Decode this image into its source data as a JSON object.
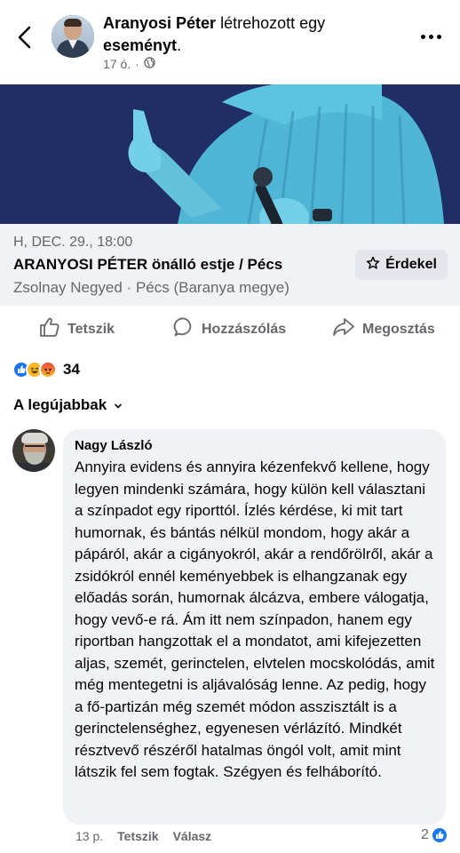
{
  "post": {
    "author": "Aranyosi Péter",
    "action": " létrehozott egy ",
    "object": "eseményt",
    "object_suffix": ".",
    "time": "17 ó.",
    "audience_icon": "globe-icon"
  },
  "event": {
    "date": "H, DEC. 29., 18:00",
    "name": "ARANYOSI PÉTER önálló estje / Pécs",
    "place": "Zsolnay Negyed · Pécs (Baranya megye)",
    "interest_label": "Érdekel"
  },
  "actions": {
    "like": "Tetszik",
    "comment": "Hozzászólás",
    "share": "Megosztás"
  },
  "reactions": {
    "count": "34",
    "types": [
      "like-icon",
      "haha-icon",
      "angry-icon"
    ]
  },
  "sort": {
    "label": "A legújabbak"
  },
  "comment": {
    "author": "Nagy László",
    "text": "Annyira evidens és annyira kézenfekvő kellene, hogy legyen mindenki számára, hogy külön kell választani a színpadot egy riporttól. Ízlés kérdése, ki mit tart humornak, és bántás nélkül mondom, hogy akár a pápáról, akár a cigányokról, akár a rendőrölről, akár a zsidókról ennél keményebbek is elhangzanak  egy előadás során, humornak álcázva, embere válogatja, hogy vevő-e rá. Ám itt nem színpadon, hanem egy riportban hangzottak el a mondatot, ami kifejezetten aljas, szemét, gerinctelen, elvtelen mocskolódás, amit még mentegetni is aljávalóság lenne. Az pedig, hogy a fő-partizán még szemét módon asszisztált is a gerinctelenséghez, egyenesen vérlázító. Mindkét résztvevő részéről hatalmas öngól volt, amit mint látszik fel sem fogtak. Szégyen és felháborító.",
    "time": "13 p.",
    "like_label": "Tetszik",
    "reply_label": "Válasz",
    "likes": "2"
  },
  "colors": {
    "accent": "#1877f2",
    "secondary_text": "#65676b",
    "bubble_bg": "#f0f2f5",
    "cover_bg": "#1f2f66"
  }
}
